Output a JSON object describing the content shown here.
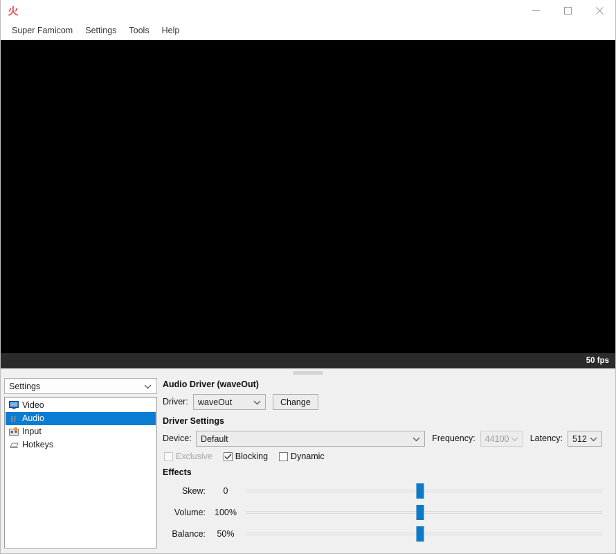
{
  "window": {
    "app_icon": "fire-kanji-icon",
    "controls": {
      "minimize": "minimize-icon",
      "maximize": "maximize-icon",
      "close": "close-icon"
    }
  },
  "menubar": {
    "items": [
      {
        "label": "Super Famicom"
      },
      {
        "label": "Settings"
      },
      {
        "label": "Tools"
      },
      {
        "label": "Help"
      }
    ]
  },
  "viewport": {
    "status": "50 fps"
  },
  "sidebar": {
    "combo_value": "Settings",
    "items": [
      {
        "label": "Video",
        "icon": "monitor-icon",
        "selected": false
      },
      {
        "label": "Audio",
        "icon": "speaker-icon",
        "selected": true
      },
      {
        "label": "Input",
        "icon": "gamepad-icon",
        "selected": false
      },
      {
        "label": "Hotkeys",
        "icon": "keyboard-icon",
        "selected": false
      }
    ]
  },
  "panel": {
    "driver_group_title": "Audio Driver (waveOut)",
    "driver_label": "Driver:",
    "driver_value": "waveOut",
    "change_button": "Change",
    "driver_settings_title": "Driver Settings",
    "device_label": "Device:",
    "device_value": "Default",
    "frequency_label": "Frequency:",
    "frequency_value": "44100",
    "latency_label": "Latency:",
    "latency_value": "512",
    "checkboxes": [
      {
        "label": "Exclusive",
        "checked": false,
        "disabled": true
      },
      {
        "label": "Blocking",
        "checked": true,
        "disabled": false
      },
      {
        "label": "Dynamic",
        "checked": false,
        "disabled": false
      }
    ],
    "effects_title": "Effects",
    "sliders": [
      {
        "label": "Skew:",
        "value": "0",
        "position_pct": 49
      },
      {
        "label": "Volume:",
        "value": "100%",
        "position_pct": 49
      },
      {
        "label": "Balance:",
        "value": "50%",
        "position_pct": 49
      }
    ]
  },
  "colors": {
    "accent": "#0a7cd4",
    "slider_handle": "#0d7ac7",
    "status_bar_bg": "#2b2b2b",
    "app_icon": "#e04343"
  }
}
